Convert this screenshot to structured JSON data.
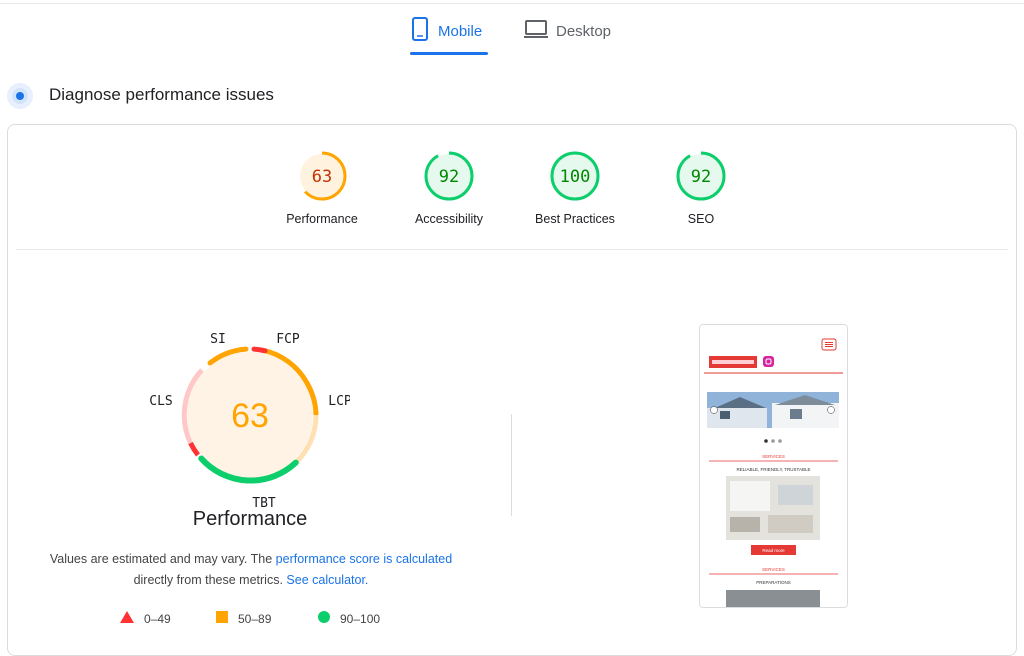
{
  "tabs": {
    "mobile_label": "Mobile",
    "desktop_label": "Desktop",
    "active": "mobile"
  },
  "section": {
    "title": "Diagnose performance issues"
  },
  "scores": [
    {
      "label": "Performance",
      "value": "63",
      "fraction": 0.63,
      "rating": "average"
    },
    {
      "label": "Accessibility",
      "value": "92",
      "fraction": 0.92,
      "rating": "pass"
    },
    {
      "label": "Best Practices",
      "value": "100",
      "fraction": 1.0,
      "rating": "pass"
    },
    {
      "label": "SEO",
      "value": "92",
      "fraction": 0.92,
      "rating": "pass"
    }
  ],
  "performance_gauge": {
    "score": "63",
    "title": "Performance",
    "metrics": {
      "si": "SI",
      "fcp": "FCP",
      "lcp": "LCP",
      "tbt": "TBT",
      "cls": "CLS"
    }
  },
  "description": {
    "text1": "Values are estimated and may vary. The",
    "link1": "performance score is calculated",
    "text2": "directly from these metrics.",
    "link2": "See calculator."
  },
  "legend": {
    "fail": "0–49",
    "average": "50–89",
    "pass": "90–100"
  },
  "colors": {
    "accent": "#1a73e8",
    "pass": "#0cce6b",
    "pass_text": "#008800",
    "average": "#ffa400",
    "average_text": "#c33300",
    "fail": "#ff3333"
  },
  "screenshot": {
    "services_1": "SERVICES",
    "tagline": "RELIABLE, FRIENDLY, TRUSTABLE",
    "read_more": "Read more",
    "services_2": "SERVICES",
    "preparations": "PREPARATIONS"
  }
}
